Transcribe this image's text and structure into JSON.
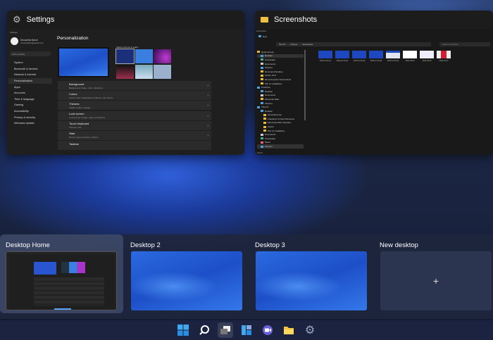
{
  "windows": {
    "settings": {
      "title": "Settings",
      "app_label": "Settings",
      "user_name": "Mousmita Barot",
      "user_email": "mousmitabarot@outlook.com",
      "search_placeholder": "Find a setting",
      "page_title": "Personalization",
      "theme_label": "Select a theme to apply",
      "nav": [
        "System",
        "Bluetooth & devices",
        "Network & internet",
        "Personalization",
        "Apps",
        "Accounts",
        "Time & language",
        "Gaming",
        "Accessibility",
        "Privacy & security",
        "Windows Update"
      ],
      "rows": [
        {
          "title": "Background",
          "sub": "Background image, color, slideshow"
        },
        {
          "title": "Colors",
          "sub": "Accent color, transparency effects, color theme"
        },
        {
          "title": "Themes",
          "sub": "Install, create, manage"
        },
        {
          "title": "Lock screen",
          "sub": "Lock screen images, apps, animations"
        },
        {
          "title": "Touch keyboard",
          "sub": "Themes, size"
        },
        {
          "title": "Start",
          "sub": "Recent apps and items, folders"
        },
        {
          "title": "Taskbar",
          "sub": ""
        }
      ]
    },
    "explorer": {
      "title": "Screenshots",
      "new_label": "New",
      "path": [
        "This PC",
        "Pictures",
        "Screenshots"
      ],
      "search_placeholder": "Search Screenshots",
      "status": "8 items",
      "sidebar": [
        "Quick access",
        "Desktop",
        "Downloads",
        "Documents",
        "Pictures",
        "Document Desktop",
        "Kinder JS-8",
        "Removing Dev Screenshots",
        "Win 11 Installation",
        "OneDrive",
        "Desktop",
        "Documents",
        "Mousmita Main",
        "Pictures",
        "This PC",
        "Desktop",
        "Final Resumes",
        "Freelance Content Resumes",
        "Mousmita Work Samples",
        "Useful",
        "Win 11 Installation",
        "Documents",
        "Downloads",
        "Music",
        "Pictures"
      ],
      "files": [
        "2020-10-29 (1)",
        "2020-10-29 (2)",
        "2020-10-29 (3)",
        "2020-10-29 (4)",
        "2020-10-29 (5)",
        "2021-03-08",
        "2021-03-09",
        "2021-03-10"
      ]
    }
  },
  "desktops": [
    {
      "label": "Desktop Home",
      "selected": true
    },
    {
      "label": "Desktop 2"
    },
    {
      "label": "Desktop 3"
    },
    {
      "label": "New desktop",
      "add_symbol": "+"
    }
  ],
  "taskbar": [
    "start-icon",
    "search-icon",
    "task-view-icon",
    "widgets-icon",
    "teams-chat-icon",
    "file-explorer-icon",
    "settings-icon"
  ]
}
